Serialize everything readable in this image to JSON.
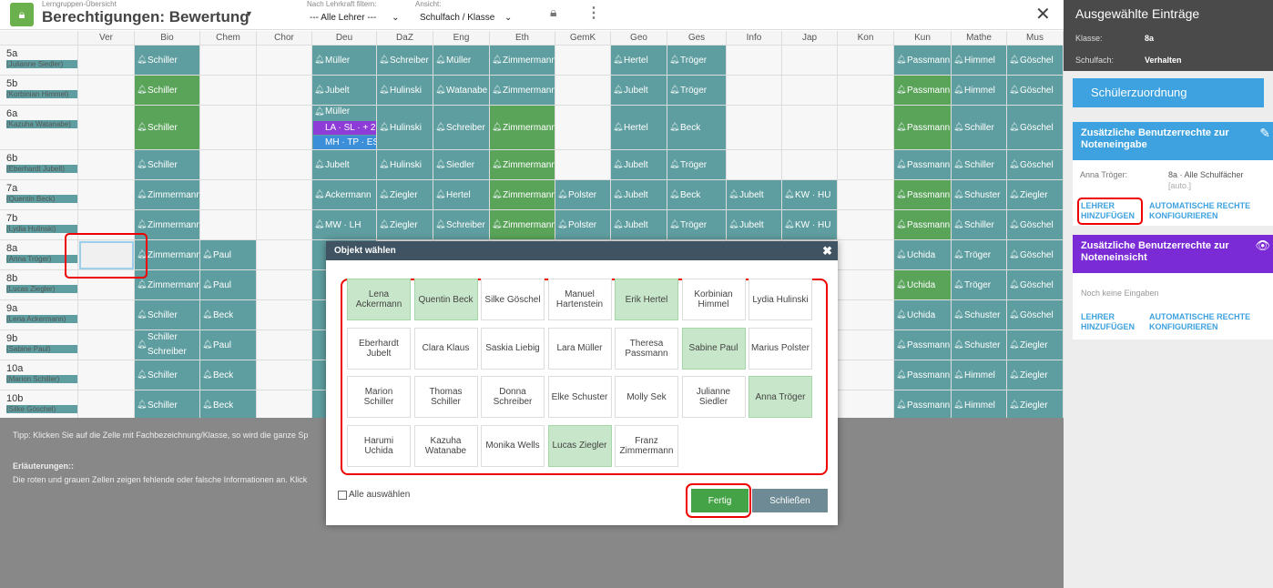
{
  "header": {
    "breadcrumb": "Lerngruppen-Übersicht",
    "title": "Berechtigungen: Bewertung",
    "filter_label": "Nach Lehrkraft filtern:",
    "filter_value": "--- Alle Lehrer ---",
    "view_label": "Ansicht:",
    "view_value": "Schulfach / Klasse"
  },
  "subjects": [
    "Ver",
    "Bio",
    "Chem",
    "Chor",
    "Deu",
    "DaZ",
    "Eng",
    "Eth",
    "GemK",
    "Geo",
    "Ges",
    "Info",
    "Jap",
    "Kon",
    "Kun",
    "Mathe",
    "Mus"
  ],
  "rows": [
    {
      "cls": "5a",
      "teacher": "(Julianne Siedler)",
      "cells": [
        null,
        [
          "t",
          "Schiller"
        ],
        null,
        null,
        [
          "t",
          "Müller"
        ],
        [
          "t",
          "Schreiber"
        ],
        [
          "t",
          "Müller"
        ],
        [
          "t",
          "Zimmermann"
        ],
        null,
        [
          "t",
          "Hertel"
        ],
        [
          "t",
          "Tröger"
        ],
        null,
        null,
        null,
        [
          "t",
          "Passmann"
        ],
        [
          "t",
          "Himmel"
        ],
        [
          "t",
          "Göschel"
        ]
      ]
    },
    {
      "cls": "5b",
      "teacher": "(Korbinian Himmel)",
      "cells": [
        null,
        [
          "g",
          "Schiller"
        ],
        null,
        null,
        [
          "t",
          "Jubelt"
        ],
        [
          "t",
          "Hulinski"
        ],
        [
          "t",
          "Watanabe"
        ],
        [
          "t",
          "Zimmermann"
        ],
        null,
        [
          "t",
          "Jubelt"
        ],
        [
          "t",
          "Tröger"
        ],
        null,
        null,
        null,
        [
          "g",
          "Passmann"
        ],
        [
          "t",
          "Himmel"
        ],
        [
          "t",
          "Göschel"
        ]
      ]
    },
    {
      "cls": "6a",
      "teacher": "(Kazuha Watanabe)",
      "cells": [
        null,
        [
          "g",
          "Schiller"
        ],
        null,
        null,
        [
          "t",
          "Müller"
        ],
        [
          "t",
          "Hulinski"
        ],
        [
          "t",
          "Schreiber"
        ],
        [
          "g",
          "Zimmermann"
        ],
        null,
        [
          "t",
          "Hertel"
        ],
        [
          "t",
          "Beck"
        ],
        null,
        null,
        null,
        [
          "g",
          "Passmann"
        ],
        [
          "t",
          "Schiller"
        ],
        [
          "t",
          "Göschel"
        ]
      ]
    },
    {
      "cls": "6b",
      "teacher": "(Eberhardt Jubelt)",
      "cells": [
        null,
        [
          "t",
          "Schiller"
        ],
        null,
        null,
        [
          "t",
          "Jubelt"
        ],
        [
          "t",
          "Hulinski"
        ],
        [
          "t",
          "Siedler"
        ],
        [
          "g",
          "Zimmermann"
        ],
        null,
        [
          "t",
          "Jubelt"
        ],
        [
          "t",
          "Tröger"
        ],
        null,
        null,
        null,
        [
          "t",
          "Passmann"
        ],
        [
          "t",
          "Schiller"
        ],
        [
          "t",
          "Göschel"
        ]
      ]
    },
    {
      "cls": "7a",
      "teacher": "(Quentin Beck)",
      "cells": [
        null,
        [
          "t",
          "Zimmermann"
        ],
        null,
        null,
        [
          "t",
          "Ackermann"
        ],
        [
          "t",
          "Ziegler"
        ],
        [
          "t",
          "Hertel"
        ],
        [
          "g",
          "Zimmermann"
        ],
        [
          "t",
          "Polster"
        ],
        [
          "t",
          "Jubelt"
        ],
        [
          "t",
          "Beck"
        ],
        [
          "t",
          "Jubelt"
        ],
        [
          "t",
          "KW · HU"
        ],
        null,
        [
          "g",
          "Passmann"
        ],
        [
          "t",
          "Schuster"
        ],
        [
          "t",
          "Ziegler"
        ]
      ]
    },
    {
      "cls": "7b",
      "teacher": "(Lydia Hulinski)",
      "cells": [
        null,
        [
          "t",
          "Zimmermann"
        ],
        null,
        null,
        [
          "t",
          "MW · LH"
        ],
        [
          "t",
          "Ziegler"
        ],
        [
          "t",
          "Schreiber"
        ],
        [
          "g",
          "Zimmermann"
        ],
        [
          "t",
          "Polster"
        ],
        [
          "t",
          "Jubelt"
        ],
        [
          "t",
          "Tröger"
        ],
        [
          "t",
          "Jubelt"
        ],
        [
          "t",
          "KW · HU"
        ],
        null,
        [
          "g",
          "Passmann"
        ],
        [
          "t",
          "Schiller"
        ],
        [
          "t",
          "Göschel"
        ]
      ]
    },
    {
      "cls": "8a",
      "teacher": "(Anna Tröger)",
      "cells": [
        null,
        [
          "t",
          "Zimmermann"
        ],
        [
          "t",
          "Paul"
        ],
        null,
        [
          "t",
          ""
        ],
        null,
        null,
        null,
        null,
        null,
        null,
        null,
        null,
        null,
        [
          "t",
          "Uchida"
        ],
        [
          "t",
          "Tröger"
        ],
        [
          "t",
          "Göschel"
        ]
      ]
    },
    {
      "cls": "8b",
      "teacher": "(Lucas Ziegler)",
      "cells": [
        null,
        [
          "t",
          "Zimmermann"
        ],
        [
          "t",
          "Paul"
        ],
        null,
        [
          "t",
          ""
        ],
        null,
        null,
        null,
        null,
        null,
        null,
        null,
        null,
        null,
        [
          "g",
          "Uchida"
        ],
        [
          "t",
          "Tröger"
        ],
        [
          "t",
          "Göschel"
        ]
      ]
    },
    {
      "cls": "9a",
      "teacher": "(Lena Ackermann)",
      "cells": [
        null,
        [
          "t",
          "Schiller"
        ],
        [
          "t",
          "Beck"
        ],
        null,
        [
          "t",
          ""
        ],
        null,
        null,
        null,
        null,
        null,
        null,
        null,
        null,
        null,
        [
          "t",
          "Uchida"
        ],
        [
          "t",
          "Schuster"
        ],
        [
          "t",
          "Göschel"
        ]
      ]
    },
    {
      "cls": "9b",
      "teacher": "(Sabine Paul)",
      "cells": [
        null,
        [
          "t",
          "Schiller Schreiber"
        ],
        [
          "t",
          "Paul"
        ],
        null,
        [
          "t",
          ""
        ],
        null,
        null,
        null,
        null,
        null,
        null,
        null,
        null,
        null,
        [
          "t",
          "Passmann"
        ],
        [
          "t",
          "Schuster"
        ],
        [
          "t",
          "Ziegler"
        ]
      ]
    },
    {
      "cls": "10a",
      "teacher": "(Marion Schiller)",
      "cells": [
        null,
        [
          "t",
          "Schiller"
        ],
        [
          "t",
          "Beck"
        ],
        null,
        [
          "t",
          ""
        ],
        null,
        null,
        null,
        null,
        null,
        null,
        null,
        null,
        null,
        [
          "t",
          "Passmann"
        ],
        [
          "t",
          "Himmel"
        ],
        [
          "t",
          "Ziegler"
        ]
      ]
    },
    {
      "cls": "10b",
      "teacher": "(Silke Göschel)",
      "cells": [
        null,
        [
          "t",
          "Schiller"
        ],
        [
          "t",
          "Beck"
        ],
        null,
        [
          "t",
          ""
        ],
        null,
        null,
        null,
        null,
        null,
        null,
        null,
        null,
        null,
        [
          "t",
          "Passmann"
        ],
        [
          "t",
          "Himmel"
        ],
        [
          "t",
          "Ziegler"
        ]
      ]
    }
  ],
  "deu_6a_extra": {
    "line1": "LA · SL · + 2",
    "line2": "MH · TP · ES"
  },
  "footer": {
    "tip": "Tipp: Klicken Sie auf die Zelle mit Fachbezeichnung/Klasse, so wird die ganze Sp",
    "explain_title": "Erläuterungen::",
    "explain_text": "Die roten und grauen Zellen zeigen fehlende oder falsche Informationen an. Klick"
  },
  "sidebar": {
    "title": "Ausgewählte Einträge",
    "klasse_label": "Klasse:",
    "klasse_value": "8a",
    "fach_label": "Schulfach:",
    "fach_value": "Verhalten",
    "assign_button": "Schülerzuordnung",
    "panel1_title": "Zusätzliche Benutzerrechte zur Noteneingabe",
    "panel1_teacher": "Anna Tröger:",
    "panel1_scope": "8a · Alle Schulfächer",
    "panel1_auto": "[auto.]",
    "panel1_add": "LEHRER HINZUFÜGEN",
    "panel1_auto_cfg": "AUTOMATISCHE RECHTE KONFIGURIEREN",
    "panel2_title": "Zusätzliche Benutzerrechte zur Noteneinsicht",
    "panel2_empty": "Noch keine Eingaben",
    "panel2_add": "LEHRER HINZUFÜGEN",
    "panel2_auto_cfg": "AUTOMATISCHE RECHTE KONFIGURIEREN",
    "accent_blue": "#3ea2e0",
    "accent_purple": "#7b2bd6"
  },
  "dialog": {
    "title": "Objekt wählen",
    "select_all": "Alle auswählen",
    "done": "Fertig",
    "close": "Schließen",
    "teachers": [
      {
        "name": "Lena Ackermann",
        "sel": true
      },
      {
        "name": "Quentin Beck",
        "sel": true
      },
      {
        "name": "Silke Göschel",
        "sel": false
      },
      {
        "name": "Manuel Hartenstein",
        "sel": false
      },
      {
        "name": "Erik Hertel",
        "sel": true
      },
      {
        "name": "Korbinian Himmel",
        "sel": false
      },
      {
        "name": "Lydia Hulinski",
        "sel": false
      },
      {
        "name": "Eberhardt Jubelt",
        "sel": false
      },
      {
        "name": "Clara Klaus",
        "sel": false
      },
      {
        "name": "Saskia Liebig",
        "sel": false
      },
      {
        "name": "Lara Müller",
        "sel": false
      },
      {
        "name": "Theresa Passmann",
        "sel": false
      },
      {
        "name": "Sabine Paul",
        "sel": true
      },
      {
        "name": "Marius Polster",
        "sel": false
      },
      {
        "name": "Marion Schiller",
        "sel": false
      },
      {
        "name": "Thomas Schiller",
        "sel": false
      },
      {
        "name": "Donna Schreiber",
        "sel": false
      },
      {
        "name": "Elke Schuster",
        "sel": false
      },
      {
        "name": "Molly Sek",
        "sel": false
      },
      {
        "name": "Julianne Siedler",
        "sel": false
      },
      {
        "name": "Anna Tröger",
        "sel": true
      },
      {
        "name": "Harumi Uchida",
        "sel": false
      },
      {
        "name": "Kazuha Watanabe",
        "sel": false
      },
      {
        "name": "Monika Wells",
        "sel": false
      },
      {
        "name": "Lucas Ziegler",
        "sel": true
      },
      {
        "name": "Franz Zimmermann",
        "sel": false
      }
    ]
  }
}
